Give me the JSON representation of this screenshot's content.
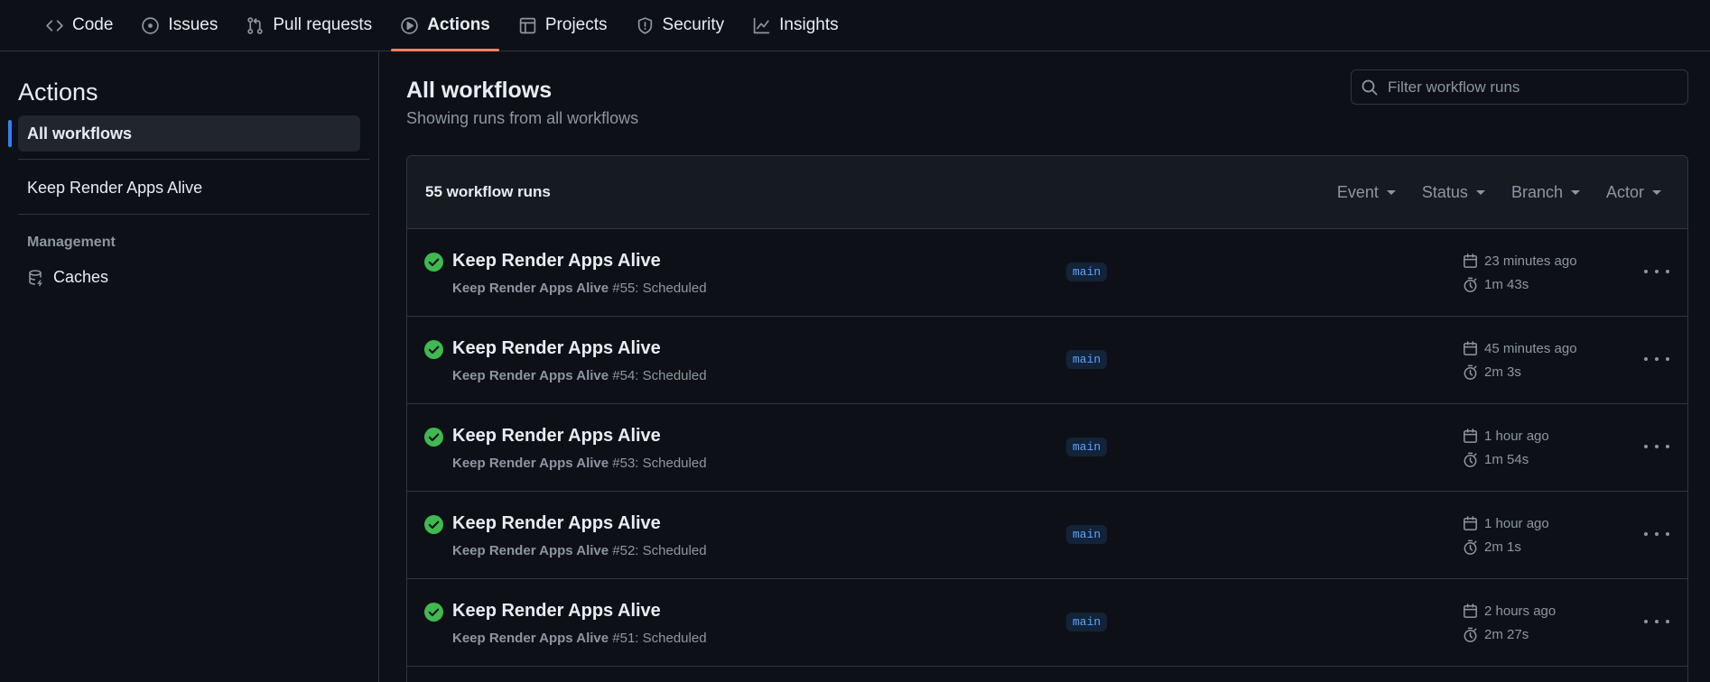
{
  "nav": {
    "tabs": [
      {
        "label": "Code",
        "icon": "code-icon"
      },
      {
        "label": "Issues",
        "icon": "issue-icon"
      },
      {
        "label": "Pull requests",
        "icon": "pull-request-icon"
      },
      {
        "label": "Actions",
        "icon": "play-icon",
        "active": true
      },
      {
        "label": "Projects",
        "icon": "table-icon"
      },
      {
        "label": "Security",
        "icon": "shield-icon"
      },
      {
        "label": "Insights",
        "icon": "graph-icon"
      }
    ],
    "accent_color": "#f78166"
  },
  "sidebar": {
    "title": "Actions",
    "active_item": "All workflows",
    "workflows": [
      "Keep Render Apps Alive"
    ],
    "management_heading": "Management",
    "caches_label": "Caches"
  },
  "main": {
    "title": "All workflows",
    "subtitle": "Showing runs from all workflows",
    "filter_placeholder": "Filter workflow runs",
    "run_count": "55 workflow runs",
    "filters": [
      "Event",
      "Status",
      "Branch",
      "Actor"
    ]
  },
  "runs": [
    {
      "title": "Keep Render Apps Alive",
      "workflow": "Keep Render Apps Alive",
      "detail": " #55: Scheduled",
      "branch": "main",
      "when": "23 minutes ago",
      "duration": "1m 43s",
      "status": "success"
    },
    {
      "title": "Keep Render Apps Alive",
      "workflow": "Keep Render Apps Alive",
      "detail": " #54: Scheduled",
      "branch": "main",
      "when": "45 minutes ago",
      "duration": "2m 3s",
      "status": "success"
    },
    {
      "title": "Keep Render Apps Alive",
      "workflow": "Keep Render Apps Alive",
      "detail": " #53: Scheduled",
      "branch": "main",
      "when": "1 hour ago",
      "duration": "1m 54s",
      "status": "success"
    },
    {
      "title": "Keep Render Apps Alive",
      "workflow": "Keep Render Apps Alive",
      "detail": " #52: Scheduled",
      "branch": "main",
      "when": "1 hour ago",
      "duration": "2m 1s",
      "status": "success"
    },
    {
      "title": "Keep Render Apps Alive",
      "workflow": "Keep Render Apps Alive",
      "detail": " #51: Scheduled",
      "branch": "main",
      "when": "2 hours ago",
      "duration": "2m 27s",
      "status": "success"
    }
  ],
  "colors": {
    "success": "#3fb950",
    "link": "#2f81f7"
  }
}
